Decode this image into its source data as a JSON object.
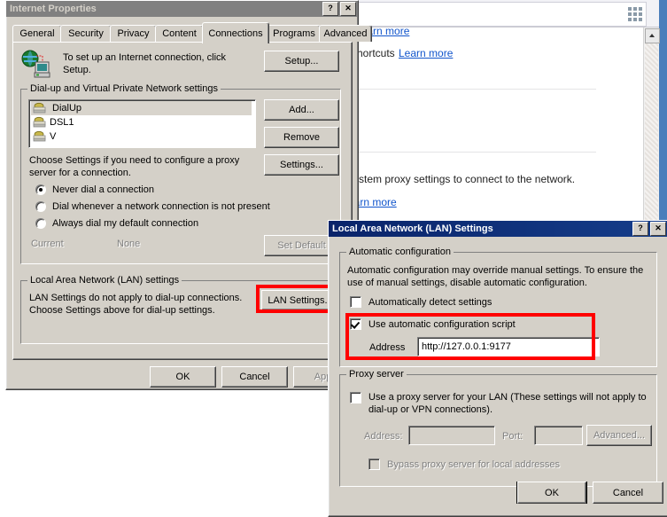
{
  "background": {
    "omnibox_apps_icon": "apps-grid-icon",
    "texts": [
      {
        "text": "shortcuts",
        "link": "Learn more"
      },
      {
        "text": "system proxy settings to connect to the network.",
        "link": "Learn more"
      }
    ],
    "partial_link_top": "Learn more",
    "shortcuts_label": "shortcuts",
    "shortcuts_link": "Learn more",
    "proxy_sentence": "system proxy settings to connect to the network.",
    "proxy_link": "earn more",
    "scrollbar_up_icon": "scroll-up-arrow-icon"
  },
  "internet_properties": {
    "title": "Internet Properties",
    "help_button": "?",
    "close_button": "✕",
    "tabs": [
      {
        "label": "General",
        "selected": false
      },
      {
        "label": "Security",
        "selected": false
      },
      {
        "label": "Privacy",
        "selected": false
      },
      {
        "label": "Content",
        "selected": false
      },
      {
        "label": "Connections",
        "selected": true
      },
      {
        "label": "Programs",
        "selected": false
      },
      {
        "label": "Advanced",
        "selected": false
      }
    ],
    "setup": {
      "icon": "internet-connection-icon",
      "description": "To set up an Internet connection, click Setup.",
      "button": "Setup..."
    },
    "dialup_group": {
      "title": "Dial-up and Virtual Private Network settings",
      "items": [
        {
          "label": "DialUp",
          "icon": "modem-icon",
          "selected": true
        },
        {
          "label": "DSL1",
          "icon": "modem-icon",
          "selected": false
        },
        {
          "label": "V",
          "icon": "modem-icon",
          "selected": false
        }
      ],
      "buttons": {
        "add": "Add...",
        "remove": "Remove",
        "settings": "Settings..."
      },
      "settings_hint": "Choose Settings if you need to configure a proxy server for a connection.",
      "radios": [
        {
          "label": "Never dial a connection",
          "selected": true
        },
        {
          "label": "Dial whenever a network connection is not present",
          "selected": false
        },
        {
          "label": "Always dial my default connection",
          "selected": false
        }
      ],
      "current_label": "Current",
      "current_value": "None",
      "set_default_button": "Set Default"
    },
    "lan_group": {
      "title": "Local Area Network (LAN) settings",
      "description_line1": "LAN Settings do not apply to dial-up connections.",
      "description_line2": "Choose Settings above for dial-up settings.",
      "button": "LAN Settings...",
      "highlighted": true
    },
    "footer_buttons": {
      "ok": "OK",
      "cancel": "Cancel",
      "apply": "Apply"
    }
  },
  "lan_settings": {
    "title": "Local Area Network (LAN) Settings",
    "help_button": "?",
    "close_button": "✕",
    "automatic_configuration": {
      "title": "Automatic configuration",
      "description": "Automatic configuration may override manual settings.  To ensure the use of manual settings, disable automatic configuration.",
      "auto_detect": {
        "label": "Automatically detect settings",
        "checked": false
      },
      "use_script": {
        "label": "Use automatic configuration script",
        "checked": true
      },
      "address_label": "Address",
      "address_value": "http://127.0.0.1:9177",
      "highlighted": true
    },
    "proxy_server": {
      "title": "Proxy server",
      "use_proxy": {
        "label": "Use a proxy server for your LAN (These settings will not apply to dial-up or VPN connections).",
        "checked": false
      },
      "address_label": "Address:",
      "address_value": "",
      "port_label": "Port:",
      "port_value": "",
      "advanced_button": "Advanced...",
      "bypass": {
        "label": "Bypass proxy server for local addresses",
        "checked": false
      }
    },
    "footer_buttons": {
      "ok": "OK",
      "cancel": "Cancel"
    }
  },
  "colors": {
    "dialog_face": "#d4d0c8",
    "active_title": "#0a246a",
    "inactive_title": "#808080",
    "highlight_red": "#ff0000",
    "link_blue": "#1155cc"
  }
}
